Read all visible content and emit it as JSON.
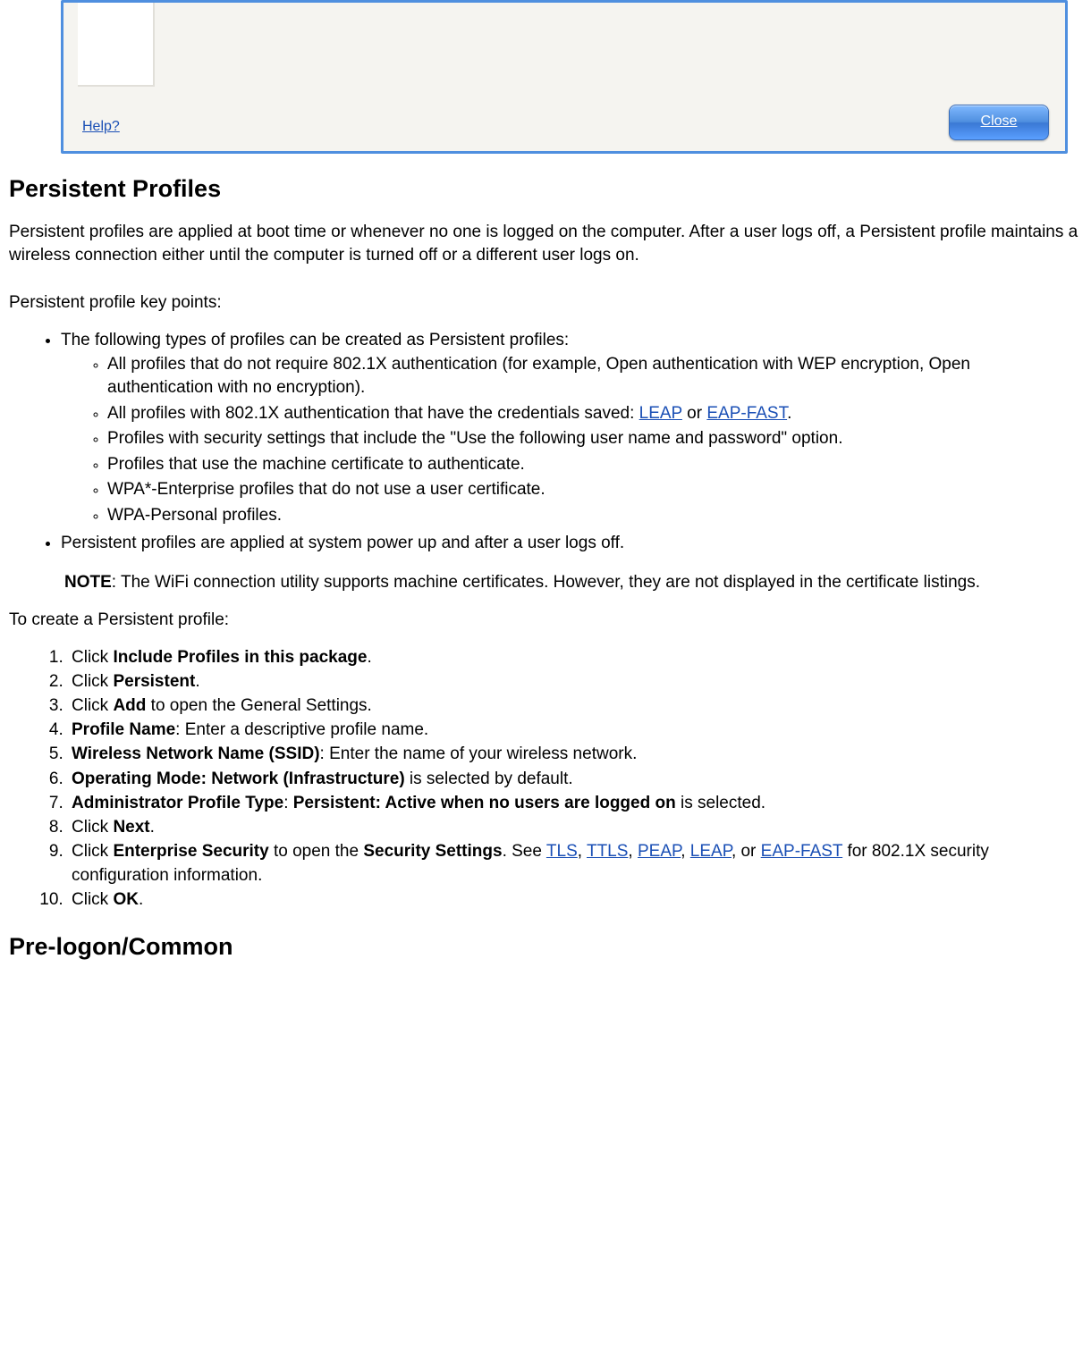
{
  "dialog": {
    "help": "Help?",
    "close": "Close"
  },
  "h_persistent": "Persistent Profiles",
  "intro": "Persistent profiles are applied at boot time or whenever no one is logged on the computer. After a user logs off, a Persistent profile maintains a wireless connection either until the computer is turned off or a different user logs on.",
  "keypoints_label": "Persistent profile key points:",
  "bullets": {
    "b0": "The following types of profiles can be created as Persistent profiles:",
    "s0": "All profiles that do not require 802.1X authentication (for example, Open authentication with WEP encryption, Open authentication with no encryption).",
    "s1a": "All profiles with 802.1X authentication that have the credentials saved: ",
    "s1_leap": "LEAP",
    "s1b": " or ",
    "s1_eap": "EAP-FAST",
    "s1c": ".",
    "s2": "Profiles with security settings that include the \"Use the following user name and password\" option.",
    "s3": "Profiles that use the machine certificate to authenticate.",
    "s4": "WPA*-Enterprise profiles that do not use a user certificate.",
    "s5": "WPA-Personal profiles.",
    "b1": "Persistent profiles are applied at system power up and after a user logs off."
  },
  "note_label": "NOTE",
  "note_text": ": The WiFi connection utility supports machine certificates. However, they are not displayed in the certificate listings.",
  "create_label": "To create a Persistent profile:",
  "steps": {
    "p1a": "Click ",
    "p1b": "Include Profiles in this package",
    "p1c": ".",
    "p2a": "Click ",
    "p2b": "Persistent",
    "p2c": ".",
    "p3a": "Click ",
    "p3b": "Add",
    "p3c": " to open the General Settings.",
    "p4a": "Profile Name",
    "p4b": ": Enter a descriptive profile name.",
    "p5a": "Wireless Network Name (SSID)",
    "p5b": ": Enter the name of your wireless network.",
    "p6a": "Operating Mode: Network (Infrastructure)",
    "p6b": " is selected by default.",
    "p7a": "Administrator Profile Type",
    "p7b": ": ",
    "p7c": "Persistent: Active when no users are logged on",
    "p7d": " is selected.",
    "p8a": "Click ",
    "p8b": "Next",
    "p8c": ".",
    "p9a": "Click ",
    "p9b": "Enterprise Security",
    "p9c": " to open the ",
    "p9d": "Security Settings",
    "p9e": ". See ",
    "p9_tls": "TLS",
    "p9f": ", ",
    "p9_ttls": "TTLS",
    "p9g": ", ",
    "p9_peap": "PEAP",
    "p9h": ", ",
    "p9_leap": "LEAP",
    "p9i": ", or ",
    "p9_eap": "EAP-FAST",
    "p9j": " for 802.1X security configuration information.",
    "p10a": "Click ",
    "p10b": "OK",
    "p10c": "."
  },
  "h_prelogon": "Pre-logon/Common"
}
